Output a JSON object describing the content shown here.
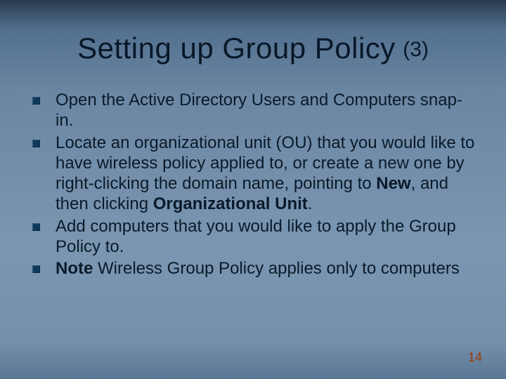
{
  "slide": {
    "title_main": "Setting up Group Policy",
    "title_suffix": "(3)",
    "bullets": [
      {
        "html": "Open the Active Directory Users and Computers snap-in."
      },
      {
        "html": "Locate an organizational unit (OU) that you would like to have wireless policy applied to, or create a new one by right-clicking the domain name, pointing to <b>New</b>, and then clicking <b>Organizational Unit</b>."
      },
      {
        "html": "Add computers that you would like to apply the Group Policy to."
      },
      {
        "html": "<b>Note</b> Wireless Group Policy applies only to computers"
      }
    ],
    "page_number": "14"
  }
}
